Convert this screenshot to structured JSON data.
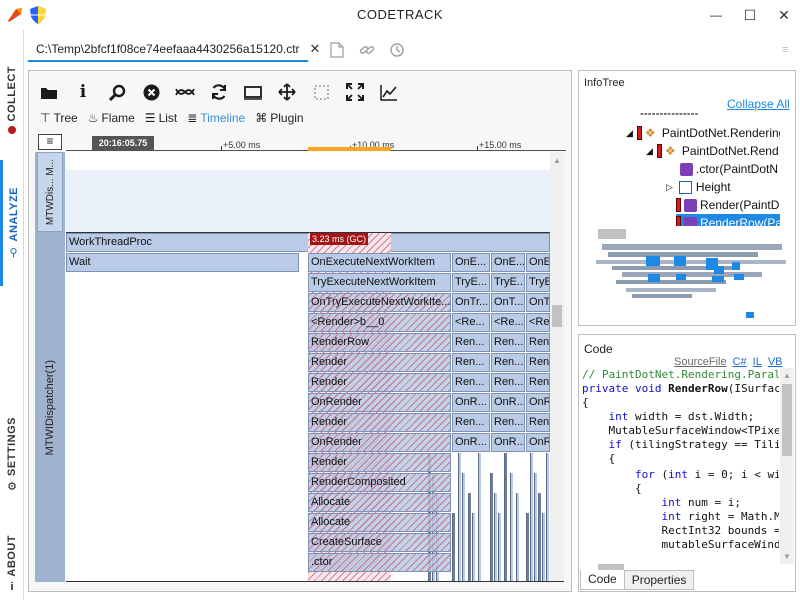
{
  "window": {
    "title": "CODETRACK",
    "minimize": "—",
    "maximize": "☐",
    "close": "✕"
  },
  "leftnav": {
    "items": [
      {
        "label": "COLLECT",
        "icon": "record-icon"
      },
      {
        "label": "ANALYZE",
        "icon": "search-icon"
      },
      {
        "label": "SETTINGS",
        "icon": "settings-icon"
      },
      {
        "label": "ABOUT",
        "icon": "info-icon"
      }
    ]
  },
  "document": {
    "tab_label": "C:\\Temp\\2bfcf1f08ce74eefaaa4430256a15120.ctr",
    "close": "✕"
  },
  "toolbar": {
    "view_tabs": [
      {
        "label": "Tree",
        "icon": "tree-icon"
      },
      {
        "label": "Flame",
        "icon": "flame-icon"
      },
      {
        "label": "List",
        "icon": "list-icon"
      },
      {
        "label": "Timeline",
        "icon": "timeline-icon",
        "active": true
      },
      {
        "label": "Plugin",
        "icon": "plugin-icon"
      }
    ]
  },
  "timeline": {
    "timestamp": "20:16:05.75",
    "ticks": [
      "+5.00 ms",
      "+10.00 ms",
      "+15.00 ms"
    ],
    "threads": [
      {
        "label": "MTWDis... M..."
      },
      {
        "label": "MTWIDispatcher(1)"
      }
    ],
    "gc_label": "3.23 ms (GC)",
    "rows": {
      "work_thread_proc": "WorkThreadProc",
      "wait": "Wait",
      "stack": [
        "OnExecuteNextWorkItem",
        "TryExecuteNextWorkItem",
        "OnTryExecuteNextWorkIte...",
        "<Render>b__0",
        "RenderRow",
        "Render",
        "Render",
        "OnRender",
        "Render",
        "OnRender",
        "Render",
        "RenderComposited",
        "Allocate",
        "Allocate",
        "CreateSurface",
        ".ctor"
      ],
      "col2": [
        "OnE...",
        "TryE...",
        "OnTr...",
        "<Re...",
        "Ren...",
        "Ren...",
        "Ren...",
        "OnR...",
        "Ren...",
        "OnR..."
      ],
      "col3": [
        "OnE...",
        "TryE...",
        "OnT...",
        "<Re...",
        "Ren...",
        "Ren...",
        "Ren...",
        "OnR...",
        "Ren...",
        "OnR..."
      ],
      "col4": [
        "OnEx",
        "TryE",
        "OnTr",
        "<Re",
        "Ren",
        "Ren",
        "Ren",
        "OnR",
        "Ren",
        "OnR"
      ]
    }
  },
  "infotree": {
    "title": "InfoTree",
    "collapse_all": "Collapse All",
    "rows": [
      {
        "label": "PaintDotNet.Rendering"
      },
      {
        "label": "PaintDotNet.Rend"
      },
      {
        "label": ".ctor(PaintDotN"
      },
      {
        "label": "Height"
      },
      {
        "label": "Render(PaintD"
      },
      {
        "label": "RenderRow(Pa"
      }
    ]
  },
  "code": {
    "title": "Code",
    "links": [
      "SourceFile",
      "C#",
      "IL",
      "VB"
    ],
    "tabs": [
      "Code",
      "Properties"
    ]
  }
}
